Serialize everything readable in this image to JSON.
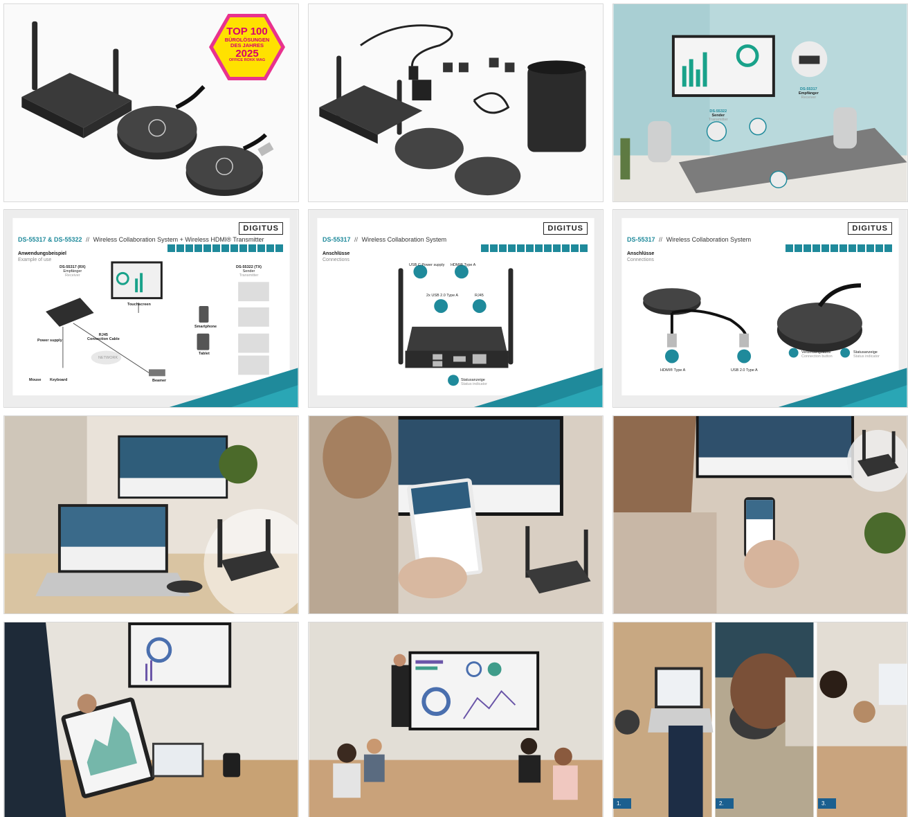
{
  "badge": {
    "line1": "TOP 100",
    "line2": "BÜROLÖSUNGEN",
    "line3": "DES JAHRES",
    "line4": "2025",
    "line5": "OFFICE ROKK MAG"
  },
  "logo": "DIGITUS",
  "slide_example": {
    "code": "DS-55317 & DS-55322",
    "sep": "//",
    "title": "Wireless Collaboration System + Wireless HDMI® Transmitter",
    "heading_de": "Anwendungsbeispiel",
    "heading_en": "Example of use",
    "receiver_code": "DS-55317 (RX)",
    "receiver_de": "Empfänger",
    "receiver_en": "Receiver",
    "sender_code": "DS-55322 (TX)",
    "sender_de": "Sender",
    "sender_en": "Transmitter",
    "touchscreen": "Touchscreen",
    "power_supply": "Power supply",
    "rj45": "RJ45",
    "rj45_cable": "Connection Cable",
    "network": "NETWORK",
    "smartphone": "Smartphone",
    "tablet": "Tablet",
    "mouse": "Mouse",
    "keyboard": "Keyboard",
    "beamer": "Beamer"
  },
  "slide_conn": {
    "code": "DS-55317",
    "sep": "//",
    "title": "Wireless Collaboration System",
    "heading_de": "Anschlüsse",
    "heading_en": "Connections",
    "usbc": "USB C Power supply",
    "hdmi": "HDMI® Type A",
    "usb2x": "2x USB 2.0 Type A",
    "rj45": "RJ45",
    "status_de": "Statusanzeige",
    "status_en": "Status indicator"
  },
  "slide_conn2": {
    "code": "DS-55317",
    "sep": "//",
    "title": "Wireless Collaboration System",
    "heading_de": "Anschlüsse",
    "heading_en": "Connections",
    "hdmi": "HDMI® Type A",
    "usb": "USB 2.0 Type A",
    "btn_de": "Verbindungstaste",
    "btn_en": "Connection button",
    "status_de": "Statusanzeige",
    "status_en": "Status indicator"
  },
  "room": {
    "receiver_code": "DS-55317",
    "receiver_de": "Empfänger",
    "receiver_en": "Receiver",
    "sender_code": "DS-55322",
    "sender_de": "Sender",
    "sender_en": "Transmitter"
  },
  "steps": [
    "1.",
    "2.",
    "3."
  ],
  "colors": {
    "teal": "#1f8a9b",
    "badge_pink": "#e8328e",
    "badge_yellow": "#ffe100",
    "step_blue": "#1b5f8f",
    "room_wall": "#b9d9dc"
  }
}
